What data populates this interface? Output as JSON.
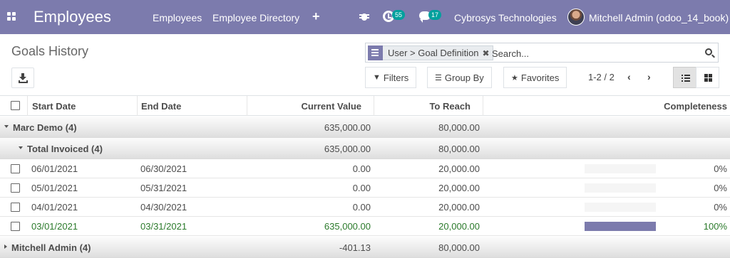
{
  "navbar": {
    "app_name": "Employees",
    "menus": [
      "Employees",
      "Employee Directory"
    ],
    "activity_count": "55",
    "message_count": "17",
    "company": "Cybrosys Technologies",
    "user": "Mitchell Admin (odoo_14_book)"
  },
  "control_panel": {
    "title": "Goals History",
    "search": {
      "facet_label": "User > Goal Definition",
      "placeholder": "Search..."
    },
    "filters_label": "Filters",
    "group_by_label": "Group By",
    "favorites_label": "Favorites",
    "pager": "1-2 / 2"
  },
  "table": {
    "headers": {
      "start_date": "Start Date",
      "end_date": "End Date",
      "current_value": "Current Value",
      "to_reach": "To Reach",
      "completeness": "Completeness"
    },
    "groups": [
      {
        "label": "Marc Demo (4)",
        "current": "635,000.00",
        "to_reach": "80,000.00"
      },
      {
        "label": "Total Invoiced (4)",
        "current": "635,000.00",
        "to_reach": "80,000.00"
      },
      {
        "label": "Mitchell Admin (4)",
        "current": "-401.13",
        "to_reach": "80,000.00"
      }
    ],
    "rows": [
      {
        "start": "06/01/2021",
        "end": "06/30/2021",
        "current": "0.00",
        "to_reach": "20,000.00",
        "completeness": "0%",
        "progress": 0
      },
      {
        "start": "05/01/2021",
        "end": "05/31/2021",
        "current": "0.00",
        "to_reach": "20,000.00",
        "completeness": "0%",
        "progress": 0
      },
      {
        "start": "04/01/2021",
        "end": "04/30/2021",
        "current": "0.00",
        "to_reach": "20,000.00",
        "completeness": "0%",
        "progress": 0
      },
      {
        "start": "03/01/2021",
        "end": "03/31/2021",
        "current": "635,000.00",
        "to_reach": "20,000.00",
        "completeness": "100%",
        "progress": 100
      }
    ]
  },
  "colors": {
    "navbar": "#7c7bad",
    "success_text": "#2b7a2b",
    "badge": "#00a09d"
  }
}
